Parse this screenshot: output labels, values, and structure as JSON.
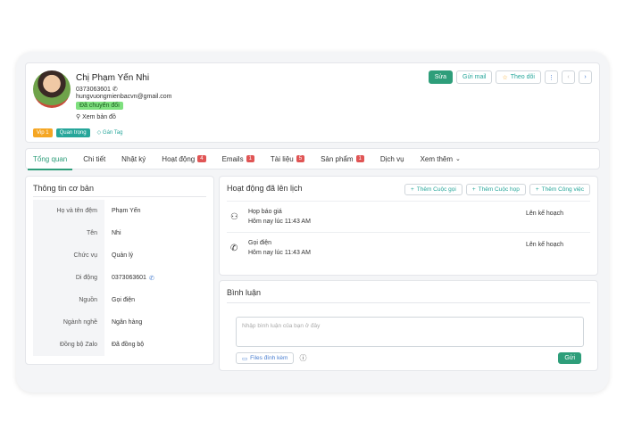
{
  "profile": {
    "name": "Chị Phạm Yến Nhi",
    "phone": "0373063601",
    "email": "hungvuongmienbacvn@gmail.com",
    "status": "Đã chuyển đổi",
    "map_link": "Xem bản đồ",
    "tags": [
      "Vip 1",
      "Quan trọng"
    ],
    "add_tag": "Gán Tag"
  },
  "actions": {
    "edit": "Sửa",
    "send_mail": "Gửi mail",
    "follow": "Theo dõi"
  },
  "tabs": [
    {
      "label": "Tổng quan",
      "badge": ""
    },
    {
      "label": "Chi tiết",
      "badge": ""
    },
    {
      "label": "Nhật ký",
      "badge": ""
    },
    {
      "label": "Hoạt động",
      "badge": "4"
    },
    {
      "label": "Emails",
      "badge": "1"
    },
    {
      "label": "Tài liệu",
      "badge": "5"
    },
    {
      "label": "Sản phẩm",
      "badge": "1"
    },
    {
      "label": "Dịch vụ",
      "badge": ""
    },
    {
      "label": "Xem thêm",
      "badge": ""
    }
  ],
  "info": {
    "title": "Thông tin cơ bản",
    "rows": [
      {
        "key": "Họ và tên đệm",
        "value": "Phạm Yến"
      },
      {
        "key": "Tên",
        "value": "Nhi"
      },
      {
        "key": "Chức vụ",
        "value": "Quản lý"
      },
      {
        "key": "Di động",
        "value": "0373063601"
      },
      {
        "key": "Nguồn",
        "value": "Gọi điện"
      },
      {
        "key": "Ngành nghề",
        "value": "Ngân hàng"
      },
      {
        "key": "Đồng bộ Zalo",
        "value": "Đã đồng bộ"
      }
    ]
  },
  "activities": {
    "title": "Hoạt động đã lên lịch",
    "add_call": "Thêm Cuộc gọi",
    "add_meeting": "Thêm Cuộc họp",
    "add_task": "Thêm Công việc",
    "items": [
      {
        "icon": "meeting-icon",
        "title": "Họp báo giá",
        "time": "Hôm nay lúc 11:43 AM",
        "status": "Lên kế hoạch"
      },
      {
        "icon": "phone-icon",
        "title": "Gọi điện",
        "time": "Hôm nay lúc 11:43 AM",
        "status": "Lên kế hoạch"
      }
    ]
  },
  "comment": {
    "title": "Bình luận",
    "placeholder": "Nhập bình luận của bạn ở đây",
    "attach": "Files đính kèm",
    "send": "Gửi"
  }
}
